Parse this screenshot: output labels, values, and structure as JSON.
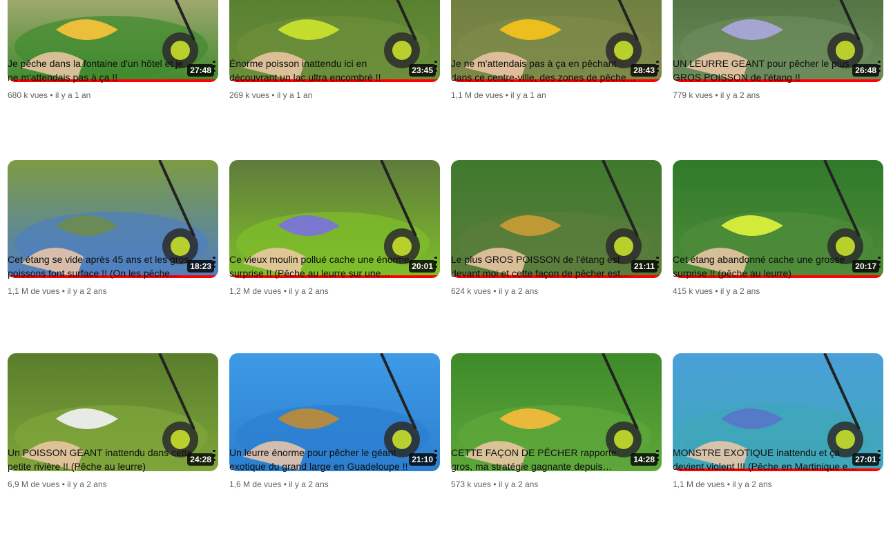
{
  "videos": [
    {
      "title": "Je pêche dans la fontaine d'un hôtel et je ne m'attendais pas à ça !!",
      "views": "680 k vues",
      "age": "il y a 1 an",
      "duration": "27:48",
      "thumb": {
        "sky": "#c9b58a",
        "water": "#3f8a2e",
        "accent": "#f3c23a"
      },
      "watched": 1.0
    },
    {
      "title": "Énorme poisson inattendu ici en découvrant un lac ultra encombré !!",
      "views": "269 k vues",
      "age": "il y a 1 an",
      "duration": "23:45",
      "thumb": {
        "sky": "#4f7a2a",
        "water": "#6c8f3b",
        "accent": "#c8e02c"
      },
      "watched": 1.0
    },
    {
      "title": "Je ne m'attendais pas à ça en pêchant dans ce centre-ville, des zones de pêche…",
      "views": "1,1 M de vues",
      "age": "il y a 1 an",
      "duration": "28:43",
      "thumb": {
        "sky": "#6b7c3c",
        "water": "#7d8a4a",
        "accent": "#f2c21d"
      },
      "watched": 1.0
    },
    {
      "title": "UN LEURRE GEANT pour pêcher le plus GROS POISSON de l'étang !!",
      "views": "779 k vues",
      "age": "il y a 2 ans",
      "duration": "26:48",
      "thumb": {
        "sky": "#4c6b3a",
        "water": "#6c8c5c",
        "accent": "#a9a7d8"
      },
      "watched": 1.0
    },
    {
      "title": "Cet étang se vide après 45 ans et les gros poissons font surface !! (On les pêche pour…",
      "views": "1,1 M de vues",
      "age": "il y a 2 ans",
      "duration": "18:23",
      "thumb": {
        "sky": "#7d9b43",
        "water": "#4f7fc2",
        "accent": "#6b8a52"
      },
      "watched": 1.0
    },
    {
      "title": "Ce vieux moulin pollué cache une énorme surprise !! (Pêche au leurre sur une rivière…",
      "views": "1,2 M de vues",
      "age": "il y a 2 ans",
      "duration": "20:01",
      "thumb": {
        "sky": "#5f7b3c",
        "water": "#7fbf2a",
        "accent": "#7a74d8"
      },
      "watched": 1.0
    },
    {
      "title": "Le plus GROS POISSON de l'étang est devant moi et cette façon de pêcher est redoutable !",
      "views": "624 k vues",
      "age": "il y a 2 ans",
      "duration": "21:11",
      "thumb": {
        "sky": "#3e7a2e",
        "water": "#5b7d3c",
        "accent": "#c49b34"
      },
      "watched": 1.0
    },
    {
      "title": "Cet étang abandonné cache une grosse surprise !! (pêche au leurre)",
      "views": "415 k vues",
      "age": "il y a 2 ans",
      "duration": "20:17",
      "thumb": {
        "sky": "#2f7a2a",
        "water": "#4f8c3a",
        "accent": "#d9f03a"
      },
      "watched": 1.0
    },
    {
      "title": "Un POISSON GÉANT inattendu dans cette petite rivière !! (Pêche au leurre)",
      "views": "6,9 M de vues",
      "age": "il y a 2 ans",
      "duration": "24:28",
      "thumb": {
        "sky": "#5a7d2c",
        "water": "#7fa53a",
        "accent": "#eeeeee"
      },
      "watched": 0.0
    },
    {
      "title": "Un leurre énorme pour pêcher le géant exotique du grand large en Guadeloupe !!",
      "views": "1,6 M de vues",
      "age": "il y a 2 ans",
      "duration": "21:10",
      "thumb": {
        "sky": "#3e9ae6",
        "water": "#2c7fd0",
        "accent": "#b98a3c"
      },
      "watched": 0.0
    },
    {
      "title": "CETTE FAÇON DE PÊCHER rapporte gros, ma stratégie gagnante depuis l'ouverture d…",
      "views": "573 k vues",
      "age": "il y a 2 ans",
      "duration": "14:28",
      "thumb": {
        "sky": "#3e8a2a",
        "water": "#5ea83a",
        "accent": "#f2b93a"
      },
      "watched": 0.0
    },
    {
      "title": "MONSTRE EXOTIQUE inattendu et ça devient violent !!! (Pêche en Martinique en float tube)",
      "views": "1,1 M de vues",
      "age": "il y a 2 ans",
      "duration": "27:01",
      "thumb": {
        "sky": "#4aa0d8",
        "water": "#3fa7b8",
        "accent": "#5577c8"
      },
      "watched": 1.0
    }
  ]
}
